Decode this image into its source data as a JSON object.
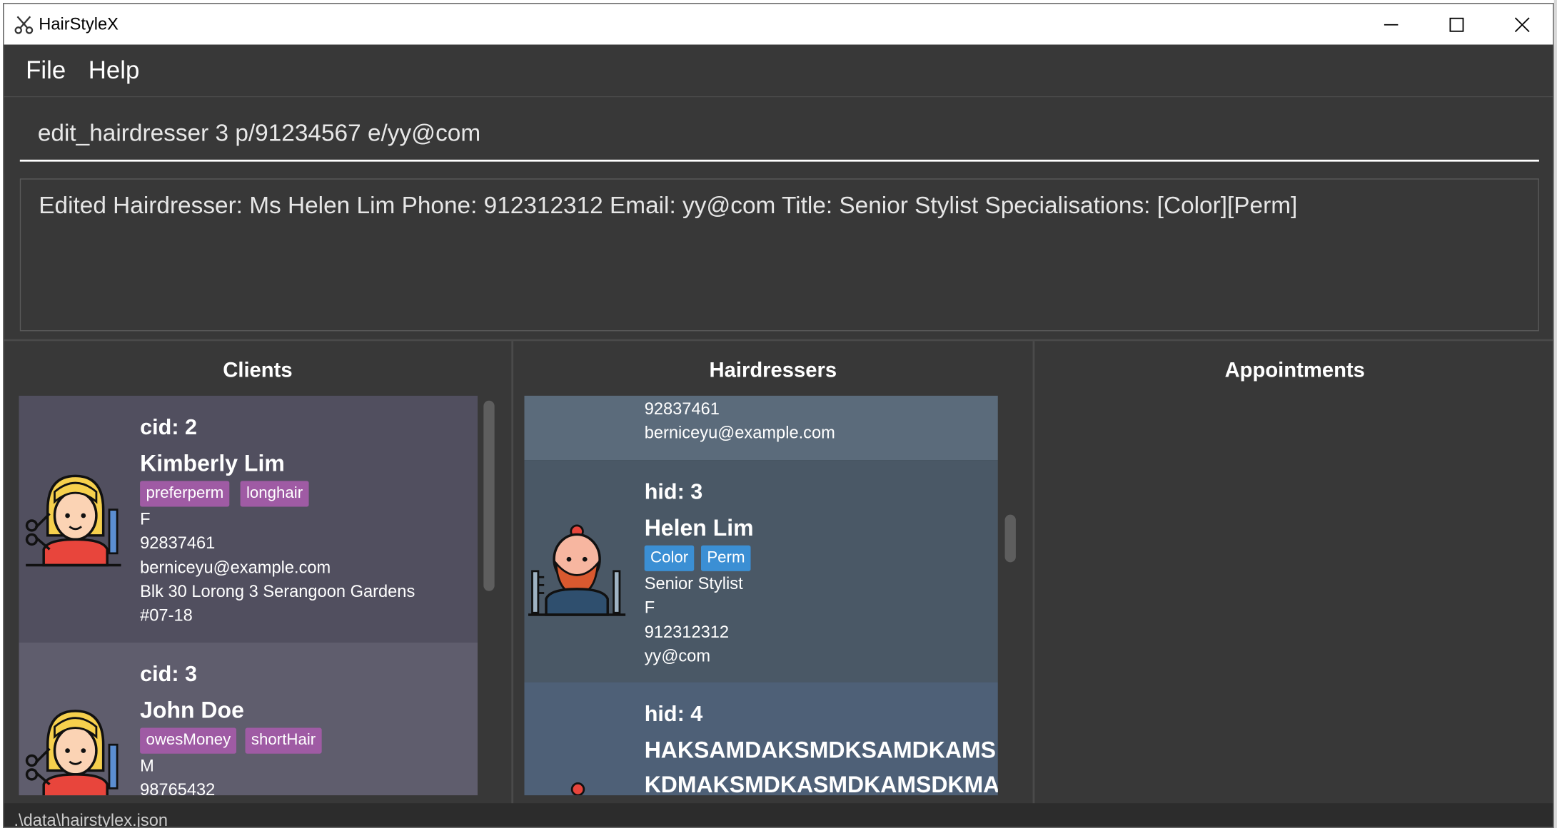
{
  "window": {
    "title": "HairStyleX",
    "controls": {
      "minimize": "minimize",
      "maximize": "maximize",
      "close": "close"
    }
  },
  "menu": {
    "items": [
      "File",
      "Help"
    ]
  },
  "command": {
    "value": "edit_hairdresser 3 p/91234567 e/yy@com"
  },
  "result": {
    "text": "Edited Hairdresser: Ms Helen Lim Phone: 912312312 Email: yy@com Title: Senior Stylist Specialisations: [Color][Perm]"
  },
  "panels": {
    "clients": {
      "title": "Clients",
      "cards": [
        {
          "id": "cid: 2",
          "name": "Kimberly Lim",
          "tags": [
            "preferperm",
            "longhair"
          ],
          "gender": "F",
          "phone": "92837461",
          "email": "berniceyu@example.com",
          "address_line1": "Blk 30 Lorong 3 Serangoon Gardens",
          "address_line2": "#07-18"
        },
        {
          "id": "cid: 3",
          "name": "John Doe",
          "tags": [
            "owesMoney",
            "shortHair"
          ],
          "gender": "M",
          "phone": "98765432"
        }
      ]
    },
    "hairdressers": {
      "title": "Hairdressers",
      "cards": [
        {
          "phone": "92837461",
          "email": "berniceyu@example.com"
        },
        {
          "id": "hid: 3",
          "name": "Helen Lim",
          "specialisations": [
            "Color",
            "Perm"
          ],
          "title": "Senior Stylist",
          "gender": "F",
          "phone": "912312312",
          "email": "yy@com"
        },
        {
          "id": "hid: 4",
          "name_line1": "HAKSAMDAKSMDKSAMDKAMS",
          "name_line2": "KDMAKSMDKASMDKAMSDKMA"
        }
      ]
    },
    "appointments": {
      "title": "Appointments"
    }
  },
  "status": {
    "text": ".\\data\\hairstylex.json"
  },
  "colors": {
    "background": "#383838",
    "client_card_1": "#514f5f",
    "client_card_2": "#5f5d6d",
    "hairdresser_card_top": "#5b6b7b",
    "hairdresser_card_mid": "#4a5866",
    "hairdresser_card_bottom": "#4e6077",
    "client_tag": "#9f5ba4",
    "spec_tag": "#3b8fd4"
  },
  "icons": [
    "scissors-icon",
    "stylist-female-avatar-icon",
    "barber-male-avatar-icon"
  ]
}
